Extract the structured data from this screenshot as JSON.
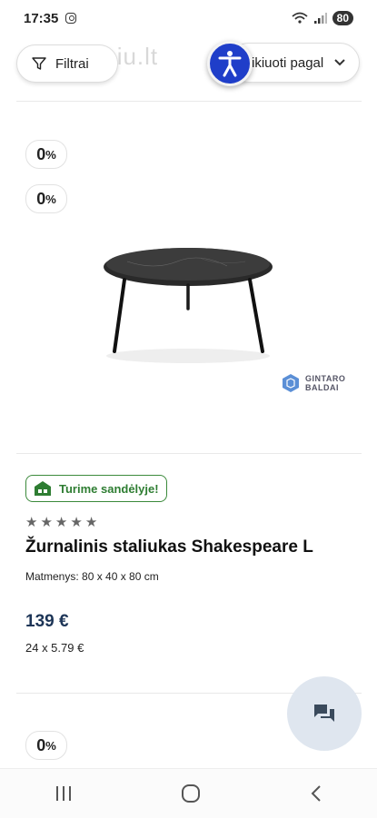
{
  "status_bar": {
    "time": "17:35",
    "battery": "80"
  },
  "toolbar": {
    "watermark": "Ji skelbiu.lt",
    "filter_label": "Filtrai",
    "sort_label": "ikiuoti pagal"
  },
  "badges": [
    {
      "value": "0",
      "unit": "%"
    },
    {
      "value": "0",
      "unit": "%"
    },
    {
      "value": "0",
      "unit": "%"
    }
  ],
  "brand": {
    "line1": "GINTARO",
    "line2": "BALDAI"
  },
  "product": {
    "stock_label": "Turime sandėlyje!",
    "rating": 0,
    "title": "Žurnalinis staliukas Shakespeare L",
    "dimensions": "Matmenys: 80 x 40 x 80 cm",
    "price": "139 €",
    "installment": "24 x 5.79 €"
  },
  "colors": {
    "accessibility": "#1f3ec9",
    "stock_green": "#2e7d32",
    "price": "#1d3557"
  }
}
